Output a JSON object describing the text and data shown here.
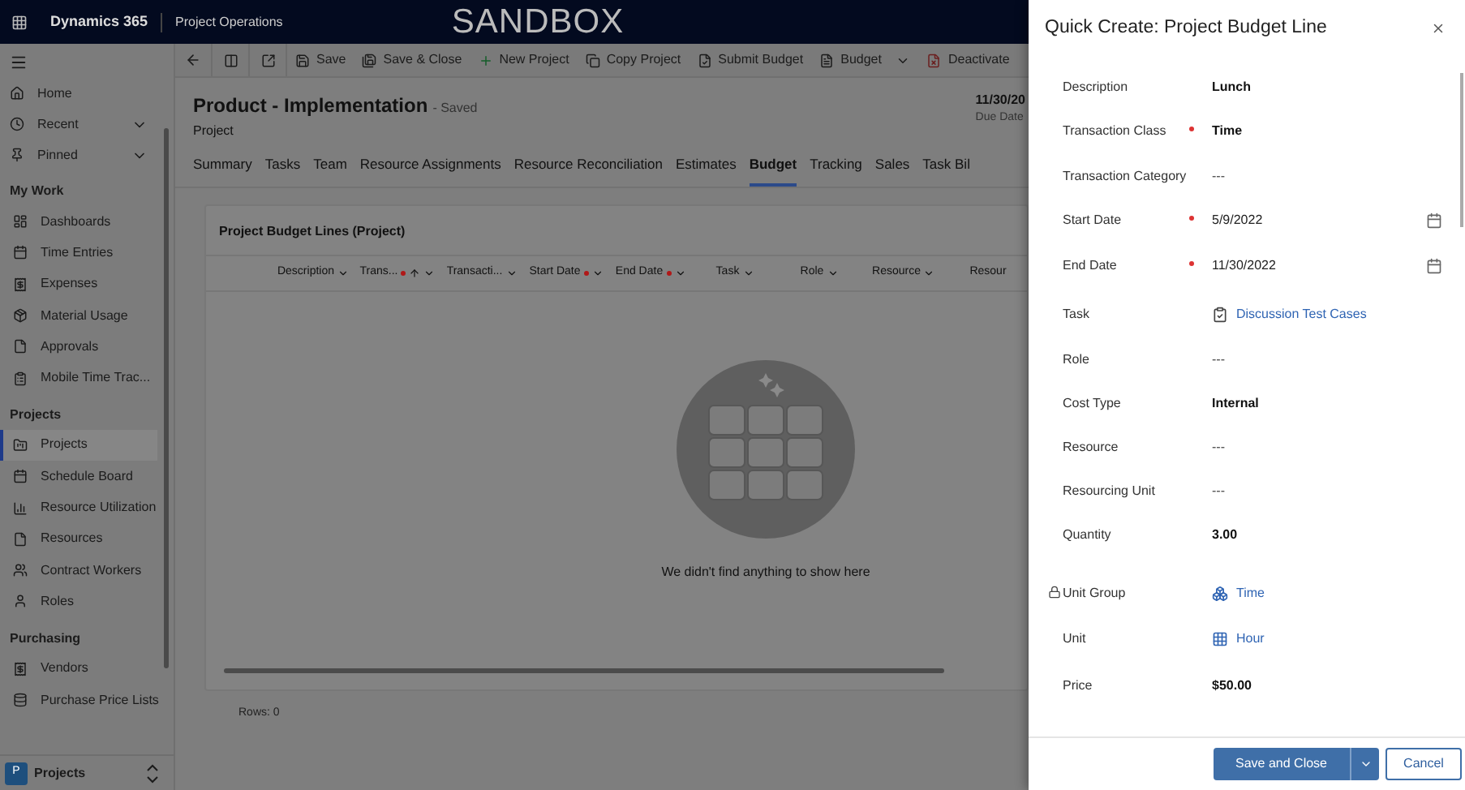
{
  "top_bar": {
    "app_name": "Dynamics 365",
    "area": "Project Operations",
    "environment": "SANDBOX"
  },
  "nav": {
    "top_items": [
      {
        "label": "Home",
        "kind": "home",
        "expandable": false
      },
      {
        "label": "Recent",
        "kind": "recent",
        "expandable": true
      },
      {
        "label": "Pinned",
        "kind": "pin",
        "expandable": true
      }
    ],
    "groups": [
      {
        "title": "My Work",
        "items": [
          {
            "label": "Dashboards",
            "kind": "dashboard",
            "selected": false
          },
          {
            "label": "Time Entries",
            "kind": "calendar",
            "selected": false
          },
          {
            "label": "Expenses",
            "kind": "receipt",
            "selected": false
          },
          {
            "label": "Material Usage",
            "kind": "box",
            "selected": false
          },
          {
            "label": "Approvals",
            "kind": "file",
            "selected": false
          },
          {
            "label": "Mobile Time Trac...",
            "kind": "clipboard",
            "selected": false
          }
        ]
      },
      {
        "title": "Projects",
        "items": [
          {
            "label": "Projects",
            "kind": "project",
            "selected": true
          },
          {
            "label": "Schedule Board",
            "kind": "calendar",
            "selected": false
          },
          {
            "label": "Resource Utilization",
            "kind": "chart",
            "selected": false
          },
          {
            "label": "Resources",
            "kind": "file",
            "selected": false
          },
          {
            "label": "Contract Workers",
            "kind": "users",
            "selected": false
          },
          {
            "label": "Roles",
            "kind": "user",
            "selected": false
          }
        ]
      },
      {
        "title": "Purchasing",
        "items": [
          {
            "label": "Vendors",
            "kind": "receipt",
            "selected": false
          },
          {
            "label": "Purchase Price Lists",
            "kind": "database",
            "selected": false
          }
        ]
      }
    ],
    "area_switcher": {
      "badge": "P",
      "label": "Projects"
    }
  },
  "command_bar": [
    {
      "label": "Save",
      "kind": "save",
      "dropdown": false
    },
    {
      "label": "Save & Close",
      "kind": "save-close",
      "dropdown": false
    },
    {
      "label": "New Project",
      "kind": "add",
      "dropdown": false
    },
    {
      "label": "Copy Project",
      "kind": "copy",
      "dropdown": false
    },
    {
      "label": "Submit Budget",
      "kind": "submit",
      "dropdown": false
    },
    {
      "label": "Budget",
      "kind": "file",
      "dropdown": true
    },
    {
      "label": "Deactivate",
      "kind": "deactivate",
      "dropdown": false
    }
  ],
  "record": {
    "title": "Product - Implementation",
    "status": "- Saved",
    "entity": "Project",
    "due_value": "11/30/20",
    "due_label": "Due Date"
  },
  "tabs": [
    {
      "label": "Summary",
      "selected": false
    },
    {
      "label": "Tasks",
      "selected": false
    },
    {
      "label": "Team",
      "selected": false
    },
    {
      "label": "Resource Assignments",
      "selected": false
    },
    {
      "label": "Resource Reconciliation",
      "selected": false
    },
    {
      "label": "Estimates",
      "selected": false
    },
    {
      "label": "Budget",
      "selected": true
    },
    {
      "label": "Tracking",
      "selected": false
    },
    {
      "label": "Sales",
      "selected": false
    },
    {
      "label": "Task Bil",
      "selected": false
    }
  ],
  "grid": {
    "title": "Project Budget Lines (Project)",
    "columns": [
      {
        "label": "Description",
        "required": false,
        "sorted": false,
        "menu": true
      },
      {
        "label": "Trans...",
        "required": true,
        "sorted": true,
        "menu": true
      },
      {
        "label": "Transacti...",
        "required": false,
        "sorted": false,
        "menu": true
      },
      {
        "label": "Start Date",
        "required": true,
        "sorted": false,
        "menu": true
      },
      {
        "label": "End Date",
        "required": true,
        "sorted": false,
        "menu": true
      },
      {
        "label": "Task",
        "required": false,
        "sorted": false,
        "menu": true
      },
      {
        "label": "Role",
        "required": false,
        "sorted": false,
        "menu": true
      },
      {
        "label": "Resource",
        "required": false,
        "sorted": false,
        "menu": true
      },
      {
        "label": "Resour",
        "required": false,
        "sorted": false,
        "menu": false
      }
    ],
    "empty_message": "We didn't find anything to show here",
    "row_count": "Rows: 0"
  },
  "quick_create": {
    "title": "Quick Create: Project Budget Line",
    "fields": [
      {
        "label": "Description",
        "value": "Lunch",
        "kind": "text",
        "required": false,
        "locked": false
      },
      {
        "label": "Transaction Class",
        "value": "Time",
        "kind": "text",
        "required": true,
        "locked": false
      },
      {
        "label": "Transaction Category",
        "value": "---",
        "kind": "empty",
        "required": false,
        "locked": false
      },
      {
        "label": "Start Date",
        "value": "5/9/2022",
        "kind": "date",
        "required": true,
        "locked": false
      },
      {
        "label": "End Date",
        "value": "11/30/2022",
        "kind": "date",
        "required": true,
        "locked": false
      },
      {
        "label": "Task",
        "value": "Discussion Test Cases",
        "kind": "task-link",
        "required": false,
        "locked": false
      },
      {
        "label": "Role",
        "value": "---",
        "kind": "empty",
        "required": false,
        "locked": false
      },
      {
        "label": "Cost Type",
        "value": "Internal",
        "kind": "text",
        "required": false,
        "locked": false
      },
      {
        "label": "Resource",
        "value": "---",
        "kind": "empty",
        "required": false,
        "locked": false
      },
      {
        "label": "Resourcing Unit",
        "value": "---",
        "kind": "empty",
        "required": false,
        "locked": false
      },
      {
        "label": "Quantity",
        "value": "3.00",
        "kind": "text",
        "required": false,
        "locked": false
      },
      {
        "label": "Unit Group",
        "value": "Time",
        "kind": "group-link",
        "required": false,
        "locked": true
      },
      {
        "label": "Unit",
        "value": "Hour",
        "kind": "unit-link",
        "required": false,
        "locked": false
      },
      {
        "label": "Price",
        "value": "$50.00",
        "kind": "text",
        "required": false,
        "locked": false
      }
    ],
    "primary_button": "Save and Close",
    "cancel_button": "Cancel"
  }
}
